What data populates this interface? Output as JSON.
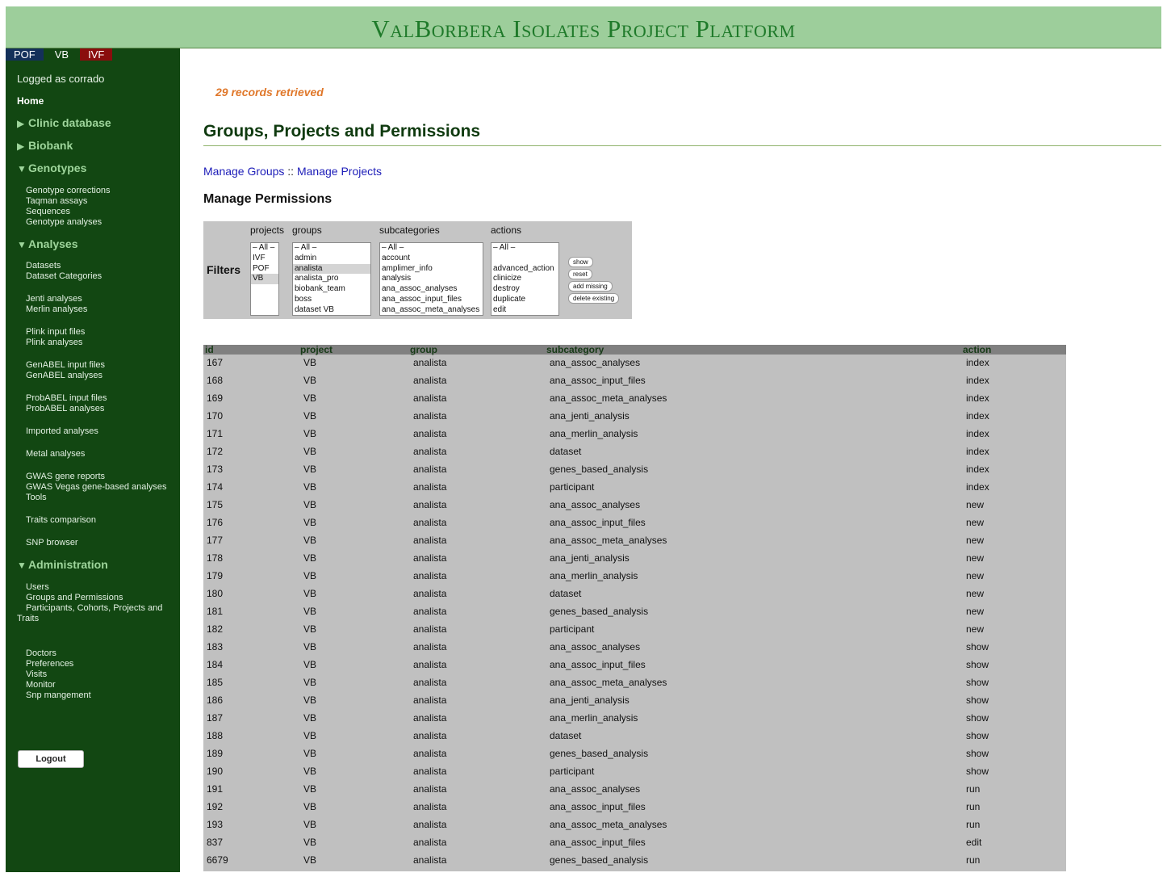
{
  "app": {
    "title": "ValBorbera Isolates Project Platform",
    "colors": {
      "banner": "#9dce9b",
      "sidebar": "#124712",
      "accent": "#e0782b",
      "link": "#1c1cb8"
    }
  },
  "project_tabs": [
    "POF",
    "VB",
    "IVF"
  ],
  "sidebar": {
    "logged": "Logged as corrado",
    "home": "Home",
    "sections": {
      "clinic": "Clinic database",
      "biobank": "Biobank",
      "genotypes": "Genotypes",
      "analyses": "Analyses",
      "admin": "Administration"
    },
    "items": {
      "genotype_corrections": "Genotype corrections",
      "taqman": "Taqman assays",
      "sequences": "Sequences",
      "genotype_analyses": "Genotype analyses",
      "datasets": "Datasets",
      "dataset_categories": "Dataset Categories",
      "jenti": "Jenti analyses",
      "merlin": "Merlin analyses",
      "plink_input": "Plink input files",
      "plink_analyses": "Plink analyses",
      "genabel_input": "GenABEL input files",
      "genabel_analyses": "GenABEL analyses",
      "probabel_input": "ProbABEL input files",
      "probabel_analyses": "ProbABEL analyses",
      "imported": "Imported analyses",
      "metal": "Metal analyses",
      "gwas_reports": "GWAS gene reports",
      "gwas_vegas": "GWAS Vegas gene-based analyses",
      "tools": "Tools",
      "traits": "Traits comparison",
      "snp_browser": "SNP browser",
      "users": "Users",
      "groups_perms": "Groups and Permissions",
      "participants": "Participants, Cohorts, Projects and Traits",
      "doctors": "Doctors",
      "preferences": "Preferences",
      "visits": "Visits",
      "monitor": "Monitor",
      "snp_mgmt": "Snp mangement"
    },
    "logout": "Logout"
  },
  "main": {
    "records": "29 records retrieved",
    "title": "Groups, Projects and Permissions",
    "manage_groups": "Manage Groups",
    "link_sep": "::",
    "manage_projects": "Manage Projects",
    "manage_permissions": "Manage Permissions"
  },
  "filters": {
    "label": "Filters",
    "headers": {
      "projects": "projects",
      "groups": "groups",
      "subcategories": "subcategories",
      "actions": "actions"
    },
    "projects": [
      "All",
      "IVF",
      "POF",
      "VB"
    ],
    "groups": [
      "All",
      "admin",
      "analista",
      "analista_pro",
      "biobank_team",
      "boss",
      "dataset VB"
    ],
    "subcategories": [
      "All",
      "account",
      "amplimer_info",
      "analysis",
      "ana_assoc_analyses",
      "ana_assoc_input_files",
      "ana_assoc_meta_analyses"
    ],
    "actions": [
      "All",
      "",
      "advanced_action",
      "clinicize",
      "destroy",
      "duplicate",
      "edit"
    ],
    "buttons": {
      "show": "show",
      "reset": "reset",
      "add_missing": "add missing",
      "delete_existing": "delete existing"
    }
  },
  "table": {
    "headers": {
      "id": "id",
      "project": "project",
      "group": "group",
      "subcategory": "subcategory",
      "action": "action"
    },
    "rows": [
      [
        "167",
        "VB",
        "analista",
        "ana_assoc_analyses",
        "index"
      ],
      [
        "168",
        "VB",
        "analista",
        "ana_assoc_input_files",
        "index"
      ],
      [
        "169",
        "VB",
        "analista",
        "ana_assoc_meta_analyses",
        "index"
      ],
      [
        "170",
        "VB",
        "analista",
        "ana_jenti_analysis",
        "index"
      ],
      [
        "171",
        "VB",
        "analista",
        "ana_merlin_analysis",
        "index"
      ],
      [
        "172",
        "VB",
        "analista",
        "dataset",
        "index"
      ],
      [
        "173",
        "VB",
        "analista",
        "genes_based_analysis",
        "index"
      ],
      [
        "174",
        "VB",
        "analista",
        "participant",
        "index"
      ],
      [
        "175",
        "VB",
        "analista",
        "ana_assoc_analyses",
        "new"
      ],
      [
        "176",
        "VB",
        "analista",
        "ana_assoc_input_files",
        "new"
      ],
      [
        "177",
        "VB",
        "analista",
        "ana_assoc_meta_analyses",
        "new"
      ],
      [
        "178",
        "VB",
        "analista",
        "ana_jenti_analysis",
        "new"
      ],
      [
        "179",
        "VB",
        "analista",
        "ana_merlin_analysis",
        "new"
      ],
      [
        "180",
        "VB",
        "analista",
        "dataset",
        "new"
      ],
      [
        "181",
        "VB",
        "analista",
        "genes_based_analysis",
        "new"
      ],
      [
        "182",
        "VB",
        "analista",
        "participant",
        "new"
      ],
      [
        "183",
        "VB",
        "analista",
        "ana_assoc_analyses",
        "show"
      ],
      [
        "184",
        "VB",
        "analista",
        "ana_assoc_input_files",
        "show"
      ],
      [
        "185",
        "VB",
        "analista",
        "ana_assoc_meta_analyses",
        "show"
      ],
      [
        "186",
        "VB",
        "analista",
        "ana_jenti_analysis",
        "show"
      ],
      [
        "187",
        "VB",
        "analista",
        "ana_merlin_analysis",
        "show"
      ],
      [
        "188",
        "VB",
        "analista",
        "dataset",
        "show"
      ],
      [
        "189",
        "VB",
        "analista",
        "genes_based_analysis",
        "show"
      ],
      [
        "190",
        "VB",
        "analista",
        "participant",
        "show"
      ],
      [
        "191",
        "VB",
        "analista",
        "ana_assoc_analyses",
        "run"
      ],
      [
        "192",
        "VB",
        "analista",
        "ana_assoc_input_files",
        "run"
      ],
      [
        "193",
        "VB",
        "analista",
        "ana_assoc_meta_analyses",
        "run"
      ],
      [
        "837",
        "VB",
        "analista",
        "ana_assoc_input_files",
        "edit"
      ],
      [
        "6679",
        "VB",
        "analista",
        "genes_based_analysis",
        "run"
      ]
    ]
  }
}
